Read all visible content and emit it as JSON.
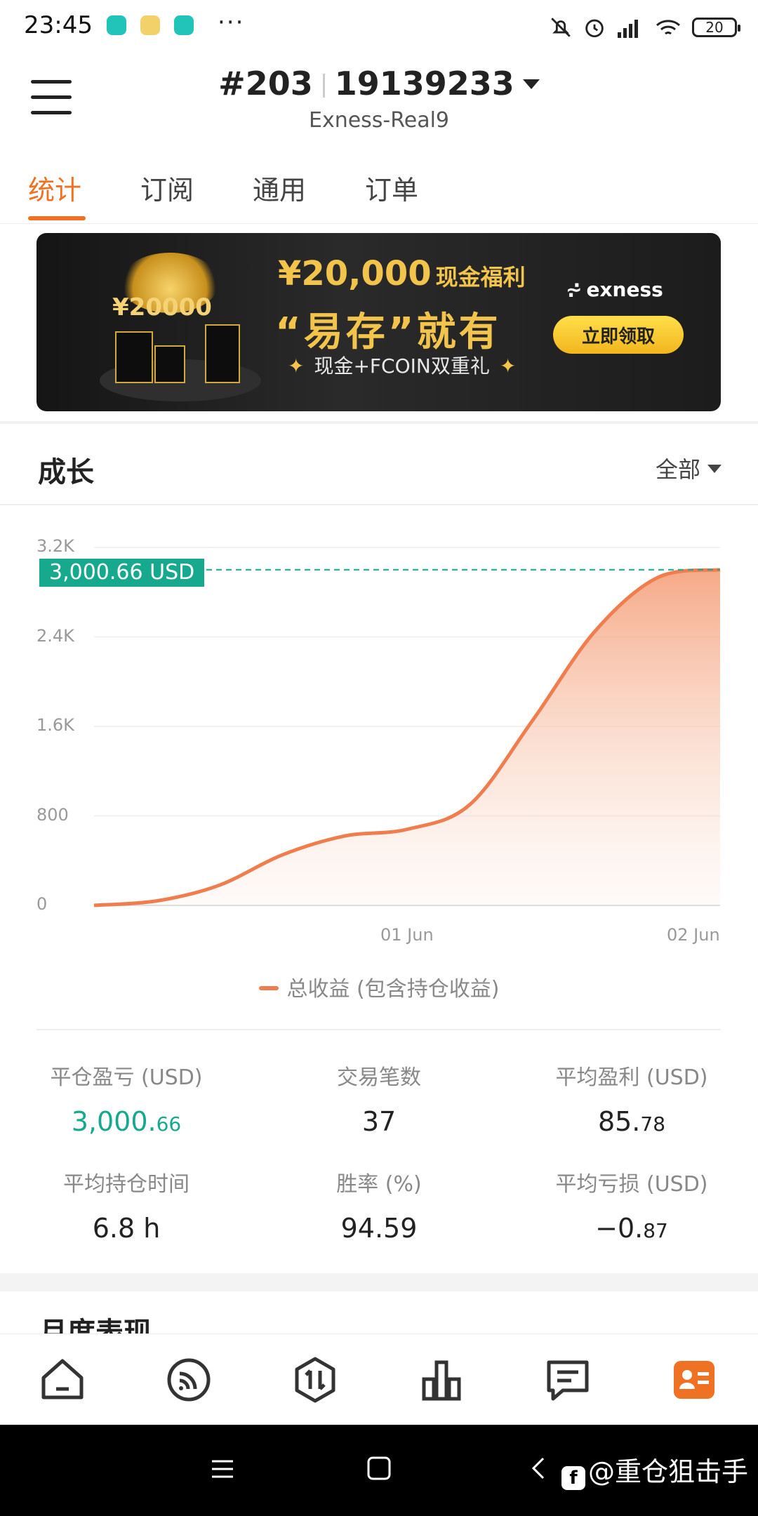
{
  "status_bar": {
    "time": "23:45",
    "dots": "···",
    "battery": "20",
    "icons": [
      "mute-icon",
      "alarm-icon",
      "signal-icon",
      "wifi-icon",
      "battery-icon"
    ]
  },
  "header": {
    "account_number": "#203",
    "account_id": "19139233",
    "server": "Exness-Real9"
  },
  "tabs": [
    {
      "label": "统计",
      "active": true
    },
    {
      "label": "订阅",
      "active": false
    },
    {
      "label": "通用",
      "active": false
    },
    {
      "label": "订单",
      "active": false
    }
  ],
  "banner": {
    "amount": "¥20,000",
    "amount_suffix": "现金福利",
    "slogan": "“易存”就有",
    "subline": "现金+FCOIN双重礼",
    "brand": "exness",
    "cta": "立即领取",
    "gift_text": "¥20000"
  },
  "growth": {
    "title": "成长",
    "range": "全部"
  },
  "chart_data": {
    "type": "area",
    "x": [
      "",
      "01 Jun",
      "02 Jun"
    ],
    "points": [
      [
        0,
        0
      ],
      [
        0.1,
        40
      ],
      [
        0.2,
        180
      ],
      [
        0.3,
        450
      ],
      [
        0.4,
        620
      ],
      [
        0.5,
        680
      ],
      [
        0.6,
        900
      ],
      [
        0.7,
        1650
      ],
      [
        0.8,
        2450
      ],
      [
        0.9,
        2930
      ],
      [
        1.0,
        3000.66
      ]
    ],
    "ylim": [
      0,
      3200
    ],
    "yticks": [
      "0",
      "800",
      "1.6K",
      "2.4K",
      "3.2K"
    ],
    "xticks": [
      "01 Jun",
      "02 Jun"
    ],
    "current_label": "3,000.66 USD",
    "series": [
      {
        "name": "总收益 (包含持仓收益)",
        "color": "#ef7d4d"
      }
    ],
    "grid": true
  },
  "legend": "总收益 (包含持仓收益)",
  "stats": {
    "closed_pnl": {
      "label": "平仓盈亏 (USD)",
      "int": "3,000.",
      "dec": "66"
    },
    "trades": {
      "label": "交易笔数",
      "value": "37"
    },
    "avg_profit": {
      "label": "平均盈利 (USD)",
      "int": "85.",
      "dec": "78"
    },
    "avg_hold": {
      "label": "平均持仓时间",
      "value": "6.8 h"
    },
    "win_rate": {
      "label": "胜率 (%)",
      "value": "94.59"
    },
    "avg_loss": {
      "label": "平均亏损 (USD)",
      "int": "−0.",
      "dec": "87"
    }
  },
  "monthly_title": "月度表现",
  "bottom_nav": [
    "home-icon",
    "feed-icon",
    "trade-icon",
    "chart-icon",
    "messages-icon",
    "profile-icon"
  ],
  "watermark": "@重仓狙击手"
}
